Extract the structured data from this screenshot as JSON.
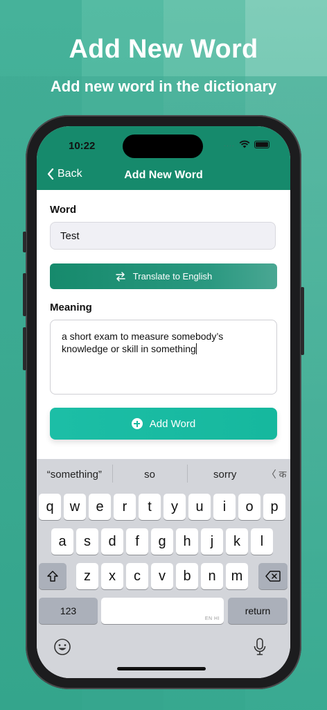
{
  "promo": {
    "headline": "Add New Word",
    "subheadline": "Add new word in the dictionary"
  },
  "status_bar": {
    "time": "10:22",
    "signal_dots": "....",
    "icons": [
      "wifi-icon",
      "battery-icon"
    ]
  },
  "nav": {
    "back_label": "Back",
    "title": "Add New Word"
  },
  "form": {
    "word_label": "Word",
    "word_value": "Test",
    "translate_label": "Translate to English",
    "meaning_label": "Meaning",
    "meaning_value": "a short exam to measure somebody’s knowledge or skill in something",
    "add_label": "Add Word"
  },
  "keyboard": {
    "suggestions": [
      "“something”",
      "so",
      "sorry"
    ],
    "lang_switch": "〈 क",
    "row1": [
      "q",
      "w",
      "e",
      "r",
      "t",
      "y",
      "u",
      "i",
      "o",
      "p"
    ],
    "row2": [
      "a",
      "s",
      "d",
      "f",
      "g",
      "h",
      "j",
      "k",
      "l"
    ],
    "row3": [
      "z",
      "x",
      "c",
      "v",
      "b",
      "n",
      "m"
    ],
    "numbers_label": "123",
    "space_hint": "EN HI",
    "return_label": "return"
  },
  "colors": {
    "header_green": "#168a6c",
    "add_button": "#17b99f",
    "background": "#3aa991"
  }
}
